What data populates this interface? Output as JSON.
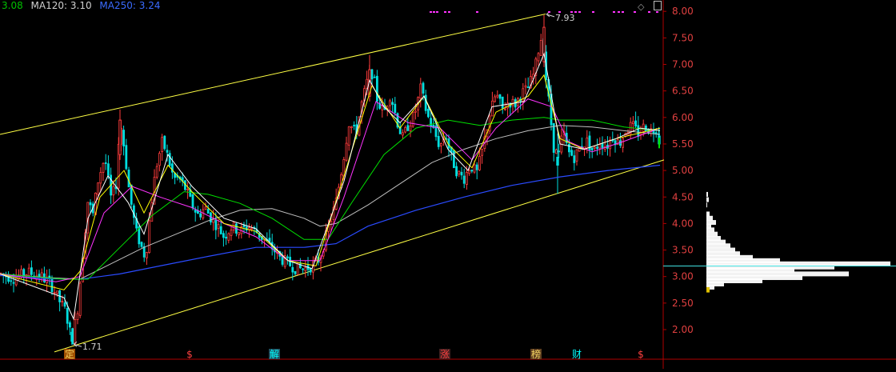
{
  "legend": {
    "ma_short": {
      "text": "3.08",
      "color": "#00c000"
    },
    "ma120": {
      "text": "MA120: 3.10",
      "color": "#d0d0d0"
    },
    "ma250": {
      "text": "MA250: 3.24",
      "color": "#3a6bff"
    }
  },
  "toolbar": {
    "diamond_icon": "diamond-icon",
    "panel_icon": "panel-icon"
  },
  "colors": {
    "up": "#ff3c3c",
    "down": "#00dede",
    "channel": "#ffff44",
    "ma5": "#ffffff",
    "ma10": "#ffff00",
    "ma20": "#ff33ff",
    "ma60": "#00e000",
    "ma120": "#bfbfbf",
    "ma250": "#2a4bff",
    "axis": "#b00000",
    "grid": "#b00000",
    "marker": "#ff33ff"
  },
  "chart_data": {
    "type": "candlestick",
    "title": "",
    "ylim": [
      1.55,
      8.05
    ],
    "y_ticks": [
      "8.00",
      "7.50",
      "7.00",
      "6.50",
      "6.00",
      "5.50",
      "5.00",
      "4.50",
      "4.00",
      "3.50",
      "3.00",
      "2.50",
      "2.00"
    ],
    "annotations": {
      "high": "7.93",
      "low": "1.71"
    },
    "price_path": [
      [
        0,
        3.05
      ],
      [
        18,
        2.97
      ],
      [
        35,
        3.08
      ],
      [
        52,
        3.0
      ],
      [
        64,
        2.85
      ],
      [
        74,
        2.55
      ],
      [
        82,
        2.35
      ],
      [
        90,
        1.78
      ],
      [
        97,
        2.4
      ],
      [
        103,
        3.35
      ],
      [
        110,
        4.45
      ],
      [
        116,
        4.15
      ],
      [
        123,
        4.85
      ],
      [
        131,
        5.25
      ],
      [
        139,
        4.45
      ],
      [
        145,
        4.75
      ],
      [
        150,
        5.95
      ],
      [
        156,
        5.35
      ],
      [
        162,
        4.55
      ],
      [
        170,
        3.85
      ],
      [
        177,
        3.55
      ],
      [
        182,
        3.35
      ],
      [
        188,
        4.25
      ],
      [
        195,
        5.05
      ],
      [
        203,
        5.55
      ],
      [
        210,
        5.25
      ],
      [
        217,
        4.85
      ],
      [
        224,
        4.85
      ],
      [
        232,
        4.65
      ],
      [
        240,
        4.35
      ],
      [
        248,
        4.15
      ],
      [
        256,
        4.3
      ],
      [
        264,
        4.1
      ],
      [
        272,
        3.95
      ],
      [
        280,
        3.75
      ],
      [
        290,
        3.95
      ],
      [
        300,
        3.85
      ],
      [
        310,
        3.95
      ],
      [
        320,
        3.85
      ],
      [
        330,
        3.7
      ],
      [
        340,
        3.55
      ],
      [
        350,
        3.35
      ],
      [
        360,
        3.25
      ],
      [
        370,
        3.15
      ],
      [
        380,
        3.15
      ],
      [
        390,
        3.2
      ],
      [
        400,
        3.35
      ],
      [
        410,
        3.9
      ],
      [
        420,
        4.4
      ],
      [
        428,
        5.1
      ],
      [
        436,
        5.9
      ],
      [
        445,
        5.7
      ],
      [
        452,
        6.25
      ],
      [
        460,
        6.75
      ],
      [
        466,
        6.85
      ],
      [
        472,
        6.3
      ],
      [
        480,
        6.1
      ],
      [
        488,
        6.45
      ],
      [
        496,
        5.95
      ],
      [
        503,
        5.6
      ],
      [
        510,
        5.85
      ],
      [
        518,
        6.05
      ],
      [
        526,
        6.55
      ],
      [
        534,
        6.05
      ],
      [
        542,
        5.75
      ],
      [
        550,
        5.45
      ],
      [
        557,
        5.7
      ],
      [
        564,
        5.25
      ],
      [
        572,
        4.95
      ],
      [
        580,
        4.85
      ],
      [
        588,
        5.1
      ],
      [
        596,
        4.95
      ],
      [
        604,
        5.45
      ],
      [
        612,
        6.05
      ],
      [
        620,
        6.45
      ],
      [
        628,
        6.15
      ],
      [
        636,
        6.3
      ],
      [
        644,
        6.25
      ],
      [
        652,
        6.45
      ],
      [
        660,
        6.55
      ],
      [
        668,
        6.85
      ],
      [
        674,
        7.35
      ],
      [
        678,
        7.6
      ],
      [
        681,
        6.95
      ],
      [
        686,
        6.3
      ],
      [
        692,
        5.45
      ],
      [
        698,
        5.25
      ],
      [
        704,
        5.75
      ],
      [
        710,
        5.35
      ],
      [
        718,
        5.25
      ],
      [
        726,
        5.45
      ],
      [
        734,
        5.55
      ],
      [
        742,
        5.35
      ],
      [
        750,
        5.55
      ],
      [
        758,
        5.45
      ],
      [
        766,
        5.65
      ],
      [
        774,
        5.5
      ],
      [
        782,
        5.75
      ],
      [
        790,
        5.85
      ],
      [
        798,
        5.7
      ],
      [
        806,
        5.85
      ],
      [
        814,
        5.75
      ],
      [
        821,
        5.8
      ],
      [
        825,
        5.7
      ]
    ],
    "highlight_candles": [
      {
        "t": 90,
        "o": 1.95,
        "h": 2.02,
        "l": 1.71,
        "c": 1.78
      },
      {
        "t": 150,
        "o": 5.3,
        "h": 6.15,
        "l": 5.2,
        "c": 5.95
      },
      {
        "t": 462,
        "o": 6.4,
        "h": 7.18,
        "l": 6.3,
        "c": 6.9
      },
      {
        "t": 680,
        "o": 7.05,
        "h": 7.93,
        "l": 6.95,
        "c": 7.7
      },
      {
        "t": 697,
        "o": 5.25,
        "h": 5.7,
        "l": 4.56,
        "c": 5.1
      },
      {
        "t": 824,
        "o": 5.65,
        "h": 5.8,
        "l": 5.42,
        "c": 5.5
      }
    ],
    "ma250_path": [
      [
        0,
        3.02
      ],
      [
        60,
        2.96
      ],
      [
        100,
        2.95
      ],
      [
        150,
        3.05
      ],
      [
        200,
        3.2
      ],
      [
        260,
        3.38
      ],
      [
        320,
        3.55
      ],
      [
        380,
        3.55
      ],
      [
        420,
        3.62
      ],
      [
        460,
        3.95
      ],
      [
        520,
        4.25
      ],
      [
        580,
        4.5
      ],
      [
        640,
        4.72
      ],
      [
        700,
        4.88
      ],
      [
        760,
        5.0
      ],
      [
        825,
        5.1
      ]
    ],
    "ma120_path": [
      [
        0,
        3.05
      ],
      [
        60,
        2.98
      ],
      [
        100,
        2.95
      ],
      [
        140,
        3.25
      ],
      [
        180,
        3.55
      ],
      [
        220,
        3.8
      ],
      [
        260,
        4.05
      ],
      [
        300,
        4.25
      ],
      [
        340,
        4.28
      ],
      [
        380,
        4.1
      ],
      [
        400,
        3.95
      ],
      [
        420,
        4.0
      ],
      [
        460,
        4.35
      ],
      [
        500,
        4.75
      ],
      [
        540,
        5.15
      ],
      [
        580,
        5.4
      ],
      [
        620,
        5.6
      ],
      [
        660,
        5.75
      ],
      [
        700,
        5.85
      ],
      [
        740,
        5.82
      ],
      [
        780,
        5.75
      ],
      [
        825,
        5.68
      ]
    ],
    "ma60_path": [
      [
        0,
        3.05
      ],
      [
        80,
        2.95
      ],
      [
        110,
        2.95
      ],
      [
        150,
        3.55
      ],
      [
        190,
        4.15
      ],
      [
        230,
        4.6
      ],
      [
        260,
        4.55
      ],
      [
        300,
        4.38
      ],
      [
        340,
        4.1
      ],
      [
        380,
        3.7
      ],
      [
        410,
        3.7
      ],
      [
        440,
        4.4
      ],
      [
        480,
        5.3
      ],
      [
        520,
        5.8
      ],
      [
        560,
        5.95
      ],
      [
        600,
        5.85
      ],
      [
        640,
        5.95
      ],
      [
        680,
        6.0
      ],
      [
        700,
        5.95
      ],
      [
        740,
        5.95
      ],
      [
        780,
        5.82
      ],
      [
        825,
        5.75
      ]
    ],
    "ma20_path": [
      [
        0,
        3.05
      ],
      [
        70,
        2.9
      ],
      [
        100,
        3.0
      ],
      [
        130,
        4.2
      ],
      [
        165,
        4.7
      ],
      [
        200,
        4.5
      ],
      [
        240,
        4.3
      ],
      [
        280,
        4.0
      ],
      [
        320,
        3.75
      ],
      [
        360,
        3.3
      ],
      [
        400,
        3.3
      ],
      [
        430,
        4.5
      ],
      [
        470,
        6.3
      ],
      [
        510,
        5.9
      ],
      [
        550,
        5.8
      ],
      [
        590,
        5.2
      ],
      [
        620,
        5.8
      ],
      [
        660,
        6.35
      ],
      [
        690,
        6.2
      ],
      [
        710,
        5.55
      ],
      [
        740,
        5.35
      ],
      [
        780,
        5.55
      ],
      [
        825,
        5.8
      ]
    ],
    "ma10_path": [
      [
        0,
        3.05
      ],
      [
        80,
        2.75
      ],
      [
        100,
        3.1
      ],
      [
        125,
        4.5
      ],
      [
        155,
        5.0
      ],
      [
        180,
        4.2
      ],
      [
        210,
        5.1
      ],
      [
        240,
        4.6
      ],
      [
        280,
        4.0
      ],
      [
        320,
        3.85
      ],
      [
        360,
        3.3
      ],
      [
        395,
        3.2
      ],
      [
        430,
        4.9
      ],
      [
        465,
        6.6
      ],
      [
        500,
        5.8
      ],
      [
        530,
        6.4
      ],
      [
        560,
        5.5
      ],
      [
        590,
        5.05
      ],
      [
        620,
        6.1
      ],
      [
        660,
        6.4
      ],
      [
        680,
        6.8
      ],
      [
        700,
        5.6
      ],
      [
        730,
        5.4
      ],
      [
        770,
        5.6
      ],
      [
        825,
        5.8
      ]
    ],
    "ma5_path": [
      [
        0,
        3.05
      ],
      [
        80,
        2.6
      ],
      [
        92,
        2.2
      ],
      [
        110,
        4.1
      ],
      [
        135,
        4.9
      ],
      [
        160,
        4.4
      ],
      [
        180,
        3.8
      ],
      [
        210,
        5.3
      ],
      [
        240,
        4.7
      ],
      [
        280,
        4.1
      ],
      [
        320,
        3.9
      ],
      [
        360,
        3.3
      ],
      [
        390,
        3.15
      ],
      [
        430,
        4.8
      ],
      [
        462,
        6.7
      ],
      [
        480,
        6.2
      ],
      [
        500,
        5.9
      ],
      [
        530,
        6.4
      ],
      [
        560,
        5.4
      ],
      [
        585,
        5.0
      ],
      [
        615,
        6.2
      ],
      [
        655,
        6.3
      ],
      [
        680,
        7.2
      ],
      [
        700,
        5.5
      ],
      [
        730,
        5.4
      ],
      [
        770,
        5.6
      ],
      [
        800,
        5.8
      ],
      [
        825,
        5.75
      ]
    ],
    "channel_upper": [
      [
        0,
        5.68
      ],
      [
        682,
        7.95
      ]
    ],
    "channel_lower": [
      [
        68,
        1.58
      ],
      [
        830,
        5.2
      ]
    ],
    "volume_profile": [
      {
        "price": 4.55,
        "w": 2
      },
      {
        "price": 4.45,
        "w": 3
      },
      {
        "price": 4.35,
        "w": 1
      },
      {
        "price": 4.18,
        "w": 4
      },
      {
        "price": 4.1,
        "w": 8
      },
      {
        "price": 4.02,
        "w": 12
      },
      {
        "price": 3.95,
        "w": 6
      },
      {
        "price": 3.88,
        "w": 10
      },
      {
        "price": 3.8,
        "w": 14
      },
      {
        "price": 3.72,
        "w": 18
      },
      {
        "price": 3.65,
        "w": 24
      },
      {
        "price": 3.58,
        "w": 30
      },
      {
        "price": 3.5,
        "w": 36
      },
      {
        "price": 3.43,
        "w": 42
      },
      {
        "price": 3.36,
        "w": 58
      },
      {
        "price": 3.3,
        "w": 92
      },
      {
        "price": 3.24,
        "w": 230
      },
      {
        "price": 3.18,
        "w": 160
      },
      {
        "price": 3.12,
        "w": 110
      },
      {
        "price": 3.05,
        "w": 178
      },
      {
        "price": 2.98,
        "w": 120
      },
      {
        "price": 2.92,
        "w": 70
      },
      {
        "price": 2.86,
        "w": 22
      },
      {
        "price": 2.8,
        "w": 10
      },
      {
        "price": 2.75,
        "w": 4
      }
    ],
    "current_price": 3.2,
    "event_markers": [
      {
        "t": 87,
        "label": "定",
        "color": "#f0d060",
        "bg": "#a05000"
      },
      {
        "t": 237,
        "label": "$",
        "color": "#ff4040",
        "bg": ""
      },
      {
        "t": 343,
        "label": "解",
        "color": "#00ffff",
        "bg": "#205060"
      },
      {
        "t": 556,
        "label": "涨",
        "color": "#ff4040",
        "bg": "#402020"
      },
      {
        "t": 670,
        "label": "榜",
        "color": "#f0d060",
        "bg": "#604020"
      },
      {
        "t": 721,
        "label": "财",
        "color": "#00ffff",
        "bg": ""
      },
      {
        "t": 801,
        "label": "$",
        "color": "#ff4040",
        "bg": ""
      }
    ],
    "top_markers_x": [
      537,
      541,
      545,
      555,
      560,
      595,
      685,
      698,
      713,
      718,
      723,
      740,
      766,
      772,
      777,
      792,
      810,
      820
    ]
  }
}
